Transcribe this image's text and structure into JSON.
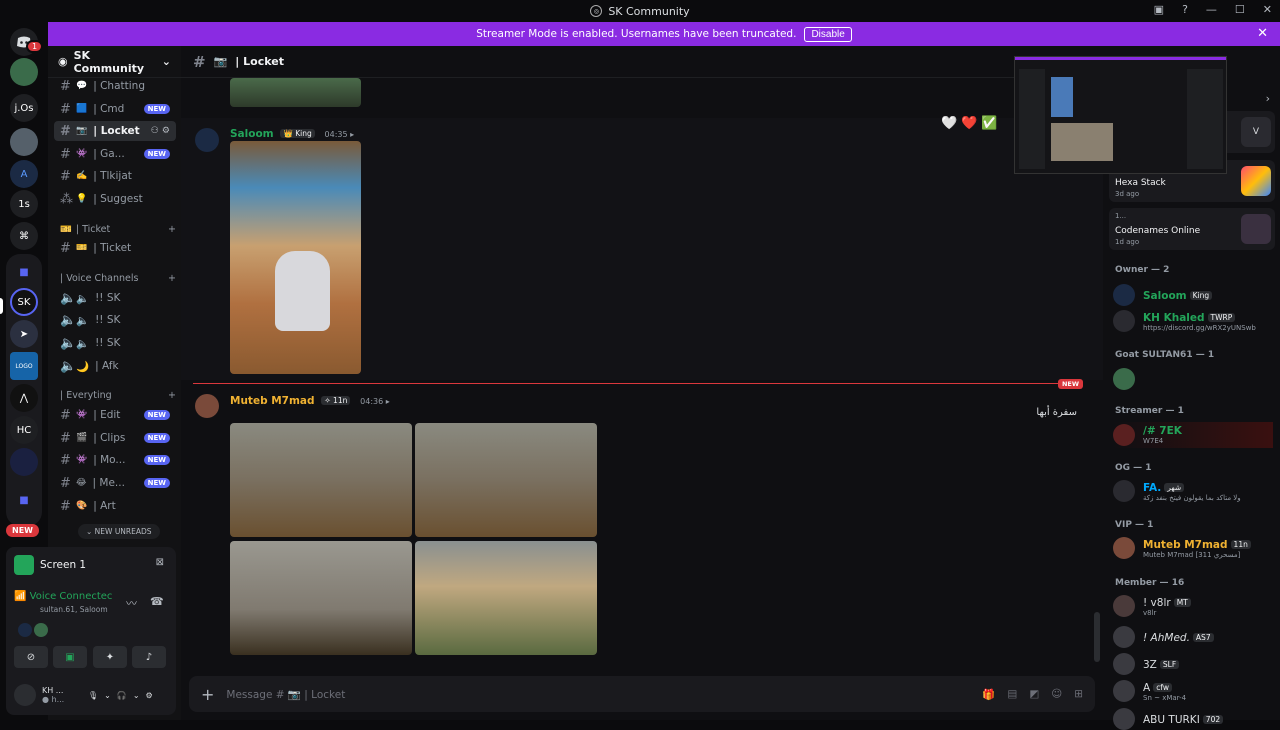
{
  "window": {
    "title": "SK Community"
  },
  "banner": {
    "text": "Streamer Mode is enabled. Usernames have been truncated.",
    "disable_label": "Disable"
  },
  "guilds": {
    "items": [
      {
        "label": "",
        "badge": "1"
      },
      {
        "label": ""
      },
      {
        "label": "j.Os"
      },
      {
        "label": ""
      },
      {
        "label": ""
      },
      {
        "label": "1s"
      },
      {
        "label": ""
      },
      {
        "label": ""
      },
      {
        "label": ""
      },
      {
        "label": ""
      },
      {
        "label": ""
      },
      {
        "label": ""
      },
      {
        "label": "HC"
      },
      {
        "label": ""
      },
      {
        "label": ""
      }
    ],
    "new_label": "NEW"
  },
  "sidebar": {
    "server_name": "SK Community",
    "channels": [
      {
        "emoji": "💬",
        "label": "| Chatting",
        "new": false
      },
      {
        "emoji": "🟦",
        "label": "| Cmd",
        "new": true
      },
      {
        "emoji": "📷",
        "label": "| Locket",
        "new": false,
        "active": true
      },
      {
        "emoji": "👾",
        "label": "| Ga...",
        "new": true
      },
      {
        "emoji": "✍️",
        "label": "| Tlkijat",
        "new": false
      },
      {
        "emoji": "💡",
        "label": "| Suggest",
        "new": false
      }
    ],
    "cat_ticket": "| Ticket",
    "ticket_channel": "| Ticket",
    "cat_voice": "| Voice Channels",
    "voice": [
      "!! SK",
      "!! SK",
      "!! SK",
      "| Afk"
    ],
    "cat_everyting": "| Everyting",
    "ev_channels": [
      {
        "emoji": "👾",
        "label": "| Edit",
        "new": true
      },
      {
        "emoji": "🎬",
        "label": "| Clips",
        "new": true
      },
      {
        "emoji": "👾",
        "label": "| Mo...",
        "new": true
      },
      {
        "emoji": "😂",
        "label": "| Me...",
        "new": true
      },
      {
        "emoji": "🎨",
        "label": "| Art",
        "new": false
      }
    ],
    "new_badge": "NEW",
    "new_unreads": "NEW UNREADS"
  },
  "panel": {
    "screen_label": "Screen 1",
    "voice_connected": "Voice Connectec",
    "voice_sub": "sultan.61, Saloom"
  },
  "user": {
    "name": "KH ...",
    "status": "● h..."
  },
  "chat": {
    "channel_name": "| Locket",
    "msg1": {
      "author": "Saloom",
      "tag": "King",
      "time": "04:35 ▸"
    },
    "msg2": {
      "author": "Muteb M7mad",
      "tag": "11n",
      "time": "04:36 ▸",
      "text": "سفرة أبها"
    },
    "new_marker": "NEW",
    "composer_placeholder": "Message # 📷 | Locket",
    "reactions": [
      "🤍",
      "❤️",
      "✅"
    ]
  },
  "members": {
    "activities": [
      {
        "name": "Hexa Stack",
        "time": "3d ago"
      },
      {
        "name": "1...",
        "time": ""
      },
      {
        "name": "Codenames Online",
        "time": "1d ago"
      }
    ],
    "groups": [
      {
        "title": "Owner — 2"
      },
      {
        "title": "Goat SULTAN61 — 1"
      },
      {
        "title": "Streamer — 1"
      },
      {
        "title": "OG — 1"
      },
      {
        "title": "VIP — 1"
      },
      {
        "title": "Member — 16"
      }
    ],
    "list": [
      {
        "name": "Saloom",
        "tag": "King",
        "sub": "",
        "color": "#23a55a"
      },
      {
        "name": "KH Khaled",
        "tag": "TWRP",
        "sub": "https://discord.gg/wRX2yUNSwb",
        "color": "#23a55a"
      },
      {
        "name": "",
        "tag": "",
        "sub": "",
        "color": "#23a55a"
      },
      {
        "name": "/# 7EK",
        "tag": "",
        "sub": "W7E4",
        "color": "#23a55a"
      },
      {
        "name": "FA.",
        "tag": "شهر",
        "sub": "ولا متأكد بما يقولون فيتخ بنفد زكة",
        "color": "#00a8fc"
      },
      {
        "name": "Muteb M7mad",
        "tag": "11n",
        "sub": "Muteb M7mad [311 مسحري]",
        "color": "#f0b232"
      },
      {
        "name": "! v8lr",
        "tag": "MT",
        "sub": "v8lr",
        "color": "#dbdee1"
      },
      {
        "name": "! AhMed.",
        "tag": "AS7",
        "sub": "",
        "color": "#dbdee1"
      },
      {
        "name": "3Z",
        "tag": "SLF",
        "sub": "",
        "color": "#dbdee1"
      },
      {
        "name": "A",
        "tag": "cfw",
        "sub": "Sn ~ xMar-4",
        "color": "#dbdee1"
      },
      {
        "name": "ABU TURKI",
        "tag": "702",
        "sub": "",
        "color": "#dbdee1"
      }
    ]
  }
}
